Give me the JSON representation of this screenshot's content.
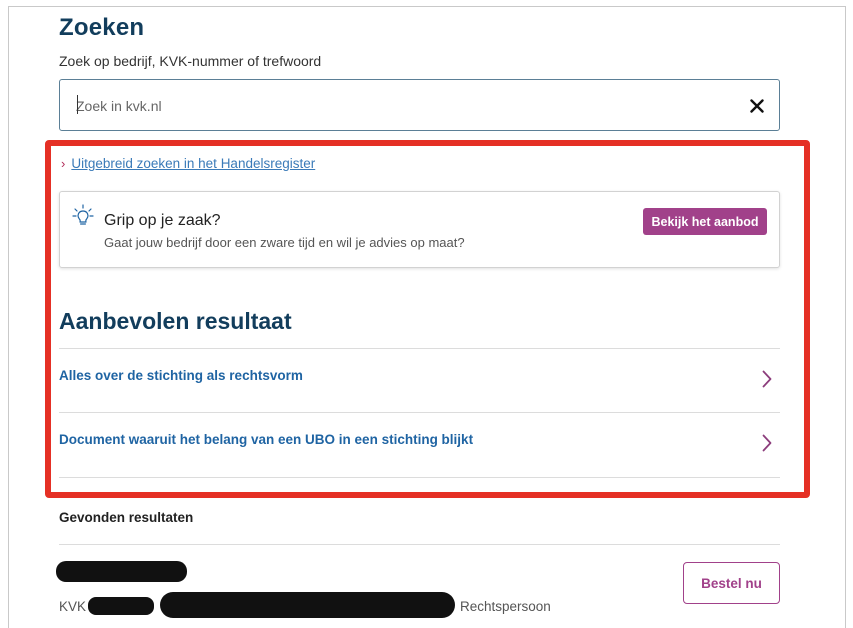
{
  "search": {
    "title": "Zoeken",
    "label": "Zoek op bedrijf, KVK-nummer of trefwoord",
    "placeholder": "Zoek in kvk.nl",
    "value": ""
  },
  "advanced_link": {
    "label": "Uitgebreid zoeken in het Handelsregister"
  },
  "promo": {
    "title": "Grip op je zaak?",
    "subtitle": "Gaat jouw bedrijf door een zware tijd en wil je advies op maat?",
    "button_label": "Bekijk het aanbod"
  },
  "recommended": {
    "title": "Aanbevolen resultaat",
    "items": [
      {
        "label": "Alles over de stichting als rechtsvorm"
      },
      {
        "label": "Document waaruit het belang van een UBO in een stichting blijkt"
      }
    ]
  },
  "found": {
    "title": "Gevonden resultaten",
    "results": [
      {
        "kvk_label": "KVK",
        "type": "Rechtspersoon",
        "button_label": "Bestel nu"
      }
    ]
  },
  "colors": {
    "heading": "#123d5c",
    "link": "#3a7ab8",
    "result_link": "#1f64a3",
    "accent": "#a1418a",
    "highlight": "#e53025"
  },
  "icons": {
    "clear": "close-icon",
    "promo": "lightbulb-icon",
    "link_chevron": "chevron-right-icon"
  }
}
